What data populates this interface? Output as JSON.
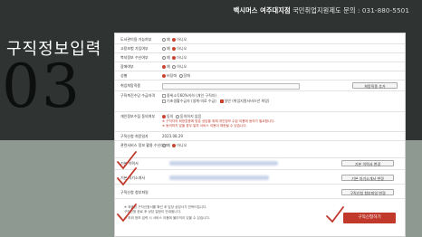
{
  "header": {
    "org": "백시머스 여주대지점",
    "inquiry": "국민취업지원제도 문의 :",
    "phone": "031-880-5501"
  },
  "slide": {
    "title": "구직정보입력",
    "number": "03"
  },
  "form": {
    "rows": [
      {
        "label": "도서관이용 가능여부",
        "opt1": "예",
        "opt2": "아니오",
        "selected": 2
      },
      {
        "label": "고용보험 가입여부",
        "opt1": "예",
        "opt2": "아니오",
        "selected": 2
      },
      {
        "label": "복지정보 수신여부",
        "opt1": "예",
        "opt2": "아니오",
        "selected": 2
      },
      {
        "label": "장애여부",
        "opt1": "예",
        "opt2": "아니오",
        "selected": 1
      },
      {
        "label": "성별",
        "opt1": "비장애",
        "opt2": "장애",
        "selected": 1
      }
    ],
    "jobseek_label": "취업희망직종",
    "jobseek_button": "희망직종 추가",
    "priority_label": "구직촉진수당 수급자격",
    "priority_options": [
      "중위소득60%이하 (개인 구직자)",
      "기초생활수급자 (생계·의료 수급)",
      "일반 (취업지원서비스만 희망)"
    ],
    "consent_label": "개인정보수집 동의여부",
    "consent_opt1": "동의",
    "consent_opt2": "동의하지 않음",
    "notice_line1": "※ 구직자의 희망업종에 맞춘 상담을 위해 개인정보 수집·이용에 동의가 필요합니다.",
    "notice_line2": "※ 동의하지 않을 경우 일부 서비스 이용이 제한될 수 있습니다.",
    "date_label": "구직신청 희망일자",
    "date_value": "2023.08.29",
    "saved_label": "관련서비스 정보 활용 수신여부",
    "saved_opt1": "예",
    "saved_opt2": "아니오",
    "resume_label": "기본 이력서",
    "resume_button": "기본 이력서 변경",
    "cover_label": "기본 자기소개서",
    "cover_button": "기본 자기소개서 변경",
    "help_label": "구직신청 첨부파일",
    "help_button": "구직신청 첨부파일 변경",
    "footnote1": "※ 제출된 구직신청서를 확인 후 담당 상담사가 연락드립니다.",
    "footnote2": "구직신청 완료 후 상담 일정이 안내됩니다.",
    "footnote3": "※ 허위 정보 입력 시 서비스 이용에 불이익이 있을 수 있습니다.",
    "submit_label": "구직신청하기"
  }
}
